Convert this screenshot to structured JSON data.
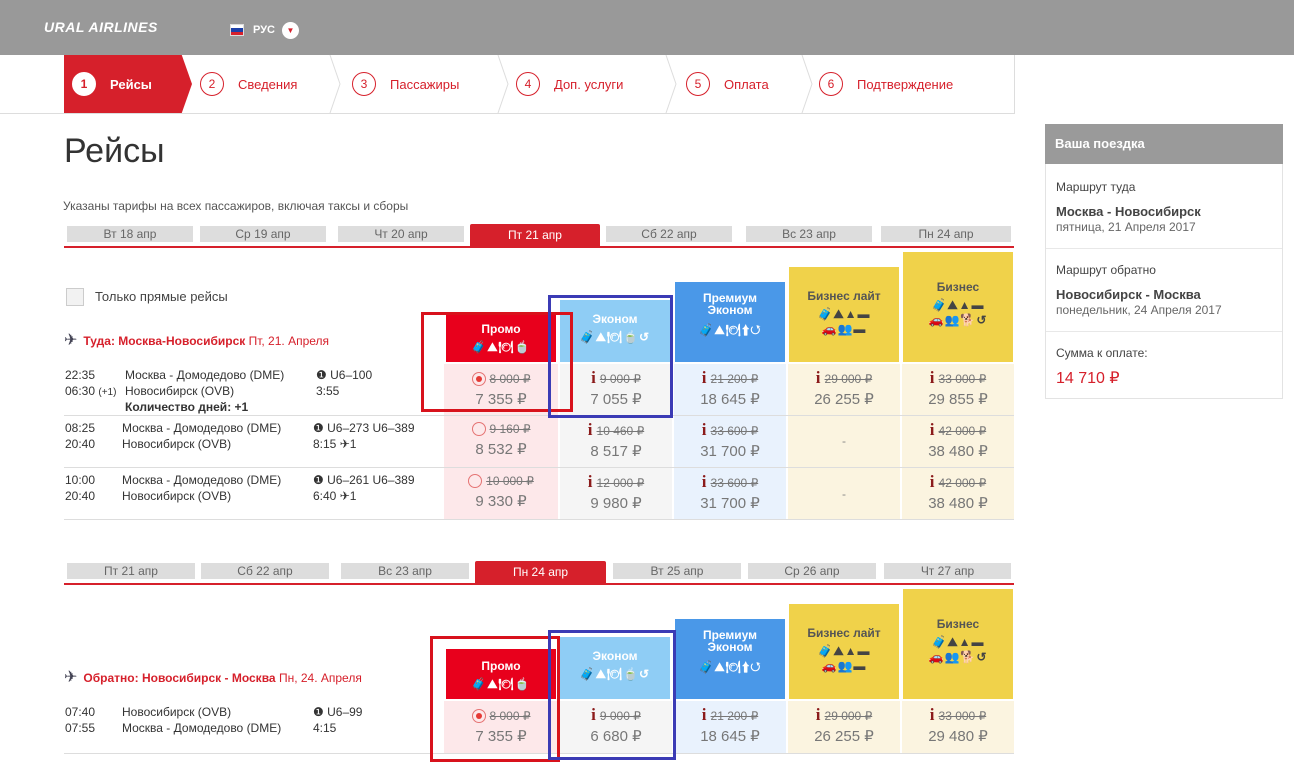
{
  "header": {
    "logo": "URAL AIRLINES",
    "lang": "РУС"
  },
  "steps": [
    {
      "n": "1",
      "label": "Рейсы"
    },
    {
      "n": "2",
      "label": "Сведения"
    },
    {
      "n": "3",
      "label": "Пассажиры"
    },
    {
      "n": "4",
      "label": "Доп. услуги"
    },
    {
      "n": "5",
      "label": "Оплата"
    },
    {
      "n": "6",
      "label": "Подтверждение"
    }
  ],
  "page": {
    "title": "Рейсы",
    "note": "Указаны тарифы на всех пассажиров, включая таксы и сборы",
    "direct_only": "Только прямые рейсы"
  },
  "dates_out": [
    "Вт 18 апр",
    "Ср 19 апр",
    "Чт 20 апр",
    "Пт 21 апр",
    "Сб 22 апр",
    "Вс 23 апр",
    "Пн 24 апр"
  ],
  "dates_back": [
    "Пт 21 апр",
    "Сб 22 апр",
    "Вс 23 апр",
    "Пн 24 апр",
    "Вт 25 апр",
    "Ср 26 апр",
    "Чт 27 апр"
  ],
  "fares": {
    "promo": "Промо",
    "econom": "Эконом",
    "premium": "Премиум Эконом",
    "blite": "Бизнес лайт",
    "business": "Бизнес"
  },
  "outbound": {
    "label": "Туда: Москва-Новосибирск",
    "date": "Пт, 21. Апреля"
  },
  "return": {
    "label": "Обратно: Новосибирск - Москва",
    "date": "Пн, 24. Апреля"
  },
  "flights_out": [
    {
      "dep": "22:35",
      "arr": "06:30",
      "plus": "(+1)",
      "from": "Москва - Домодедово (DME)",
      "to": "Новосибирск (OVB)",
      "extra": "Количество дней: +1",
      "num": "U6–100",
      "dur": "3:55",
      "stops": "",
      "promo_old": "8 000 ₽",
      "promo": "7 355 ₽",
      "econ_old": "9 000 ₽",
      "econ": "7 055 ₽",
      "prem_old": "21 200 ₽",
      "prem": "18 645 ₽",
      "bl_old": "29 000 ₽",
      "bl": "26 255 ₽",
      "bus_old": "33 000 ₽",
      "bus": "29 855 ₽"
    },
    {
      "dep": "08:25",
      "arr": "20:40",
      "from": "Москва - Домодедово (DME)",
      "to": "Новосибирск (OVB)",
      "num": "U6–273  U6–389",
      "dur": "8:15",
      "stops": "1",
      "promo_old": "9 160 ₽",
      "promo": "8 532 ₽",
      "econ_old": "10 460 ₽",
      "econ": "8 517 ₽",
      "prem_old": "33 600 ₽",
      "prem": "31 700 ₽",
      "bl": "-",
      "bus_old": "42 000 ₽",
      "bus": "38 480 ₽"
    },
    {
      "dep": "10:00",
      "arr": "20:40",
      "from": "Москва - Домодедово (DME)",
      "to": "Новосибирск (OVB)",
      "num": "U6–261  U6–389",
      "dur": "6:40",
      "stops": "1",
      "promo_old": "10 000 ₽",
      "promo": "9 330 ₽",
      "econ_old": "12 000 ₽",
      "econ": "9 980 ₽",
      "prem_old": "33 600 ₽",
      "prem": "31 700 ₽",
      "bl": "-",
      "bus_old": "42 000 ₽",
      "bus": "38 480 ₽"
    }
  ],
  "flights_back": [
    {
      "dep": "07:40",
      "arr": "07:55",
      "from": "Новосибирск (OVB)",
      "to": "Москва - Домодедово (DME)",
      "num": "U6–99",
      "dur": "4:15",
      "promo_old": "8 000 ₽",
      "promo": "7 355 ₽",
      "econ_old": "9 000 ₽",
      "econ": "6 680 ₽",
      "prem_old": "21 200 ₽",
      "prem": "18 645 ₽",
      "bl_old": "29 000 ₽",
      "bl": "26 255 ₽",
      "bus_old": "33 000 ₽",
      "bus": "29 480 ₽"
    }
  ],
  "trip": {
    "title": "Ваша поездка",
    "out_label": "Маршрут туда",
    "out_route": "Москва - Новосибирск",
    "out_date": "пятница, 21 Апреля 2017",
    "back_label": "Маршрут обратно",
    "back_route": "Новосибирск - Москва",
    "back_date": "понедельник, 24 Апреля 2017",
    "sum_label": "Сумма к оплате:",
    "sum": "14 710 ₽"
  },
  "colors": {
    "red": "#d6202b",
    "promo": "#e8001c",
    "econ": "#8fcdf5",
    "premium": "#4a98e8",
    "business": "#f0d24a"
  },
  "icons": {
    "plane": "✈",
    "luggage": "bag-icon",
    "meal": "meal-icon"
  }
}
